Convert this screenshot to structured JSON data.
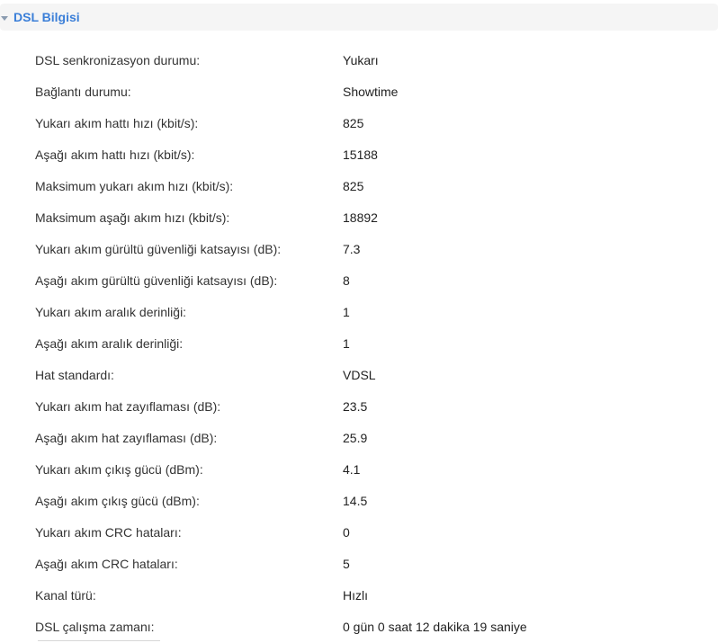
{
  "section": {
    "title": "DSL Bilgisi",
    "icon": "caret-down-icon"
  },
  "rows": [
    {
      "label": "DSL senkronizasyon durumu:",
      "value": "Yukarı"
    },
    {
      "label": "Bağlantı durumu:",
      "value": "Showtime"
    },
    {
      "label": "Yukarı akım hattı hızı (kbit/s):",
      "value": "825"
    },
    {
      "label": "Aşağı akım hattı hızı (kbit/s):",
      "value": "15188"
    },
    {
      "label": "Maksimum yukarı akım hızı (kbit/s):",
      "value": "825"
    },
    {
      "label": "Maksimum aşağı akım hızı (kbit/s):",
      "value": "18892"
    },
    {
      "label": "Yukarı akım gürültü güvenliği katsayısı (dB):",
      "value": "7.3"
    },
    {
      "label": "Aşağı akım gürültü güvenliği katsayısı (dB):",
      "value": "8"
    },
    {
      "label": "Yukarı akım aralık derinliği:",
      "value": "1"
    },
    {
      "label": "Aşağı akım aralık derinliği:",
      "value": "1"
    },
    {
      "label": "Hat standardı:",
      "value": "VDSL"
    },
    {
      "label": "Yukarı akım hat zayıflaması (dB):",
      "value": "23.5"
    },
    {
      "label": "Aşağı akım hat zayıflaması (dB):",
      "value": "25.9"
    },
    {
      "label": "Yukarı akım çıkış gücü (dBm):",
      "value": "4.1"
    },
    {
      "label": "Aşağı akım çıkış gücü (dBm):",
      "value": "14.5"
    },
    {
      "label": "Yukarı akım CRC hataları:",
      "value": "0"
    },
    {
      "label": "Aşağı akım CRC hataları:",
      "value": "5"
    },
    {
      "label": "Kanal türü:",
      "value": "Hızlı"
    },
    {
      "label": "DSL çalışma zamanı:",
      "value": "0 gün 0 saat 12 dakika 19 saniye"
    }
  ]
}
